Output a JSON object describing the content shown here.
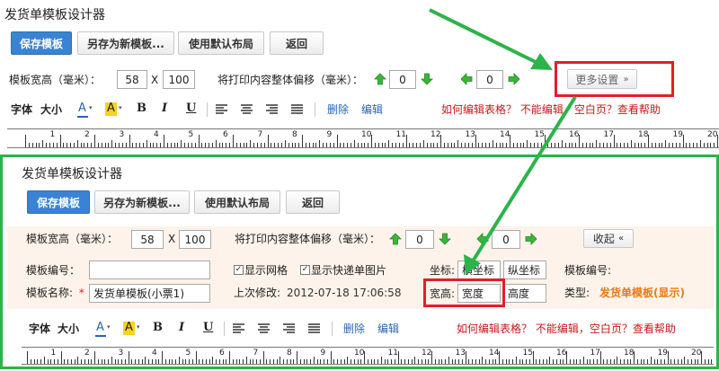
{
  "app_title": "发货单模板设计器",
  "buttons": {
    "save": "保存模板",
    "save_as": "另存为新模板...",
    "default_layout": "使用默认布局",
    "back": "返回",
    "more": "更多设置",
    "collapse": "收起"
  },
  "size": {
    "label": "模板宽高（毫米）：",
    "width": "58",
    "x": "X",
    "height": "100"
  },
  "offset": {
    "label": "将打印内容整体偏移（毫米）：",
    "vertical": "0",
    "horizontal": "0"
  },
  "format_toolbar": {
    "font": "字体",
    "size": "大小",
    "color": "A",
    "highlight": "A",
    "bold": "B",
    "italic": "I",
    "underline": "U",
    "delete": "删除",
    "edit": "编辑",
    "help": "如何编辑表格？ 不能编辑，空白页？查看帮助"
  },
  "settings": {
    "code_label": "模板编号：",
    "code_value": "",
    "name_label": "模板名称:",
    "name_required": "*",
    "name_value": "发货单模板(小票1)",
    "show_grid": "显示网格",
    "show_express": "显示快递单图片",
    "last_modified_label": "上次修改:",
    "last_modified_value": "2012-07-18 17:06:58",
    "coord_label": "坐标:",
    "x_placeholder": "横坐标",
    "y_placeholder": "纵坐标",
    "wh_label": "宽高:",
    "w_placeholder": "宽度",
    "h_placeholder": "高度",
    "code_label2": "模板编号:",
    "type_label": "类型:",
    "type_value": "发货单模板(显示)"
  },
  "ruler_labels": [
    "1",
    "2",
    "3",
    "4",
    "5",
    "6",
    "7",
    "8",
    "9",
    "10",
    "11",
    "12",
    "13",
    "14",
    "15",
    "16",
    "17",
    "18",
    "19",
    "20"
  ],
  "colors": {
    "primary": "#3a83d4",
    "highlight_red": "#e0202a",
    "annotation_green": "#2cb34a",
    "orange_text": "#e87a1a",
    "link": "#2a64b6"
  }
}
